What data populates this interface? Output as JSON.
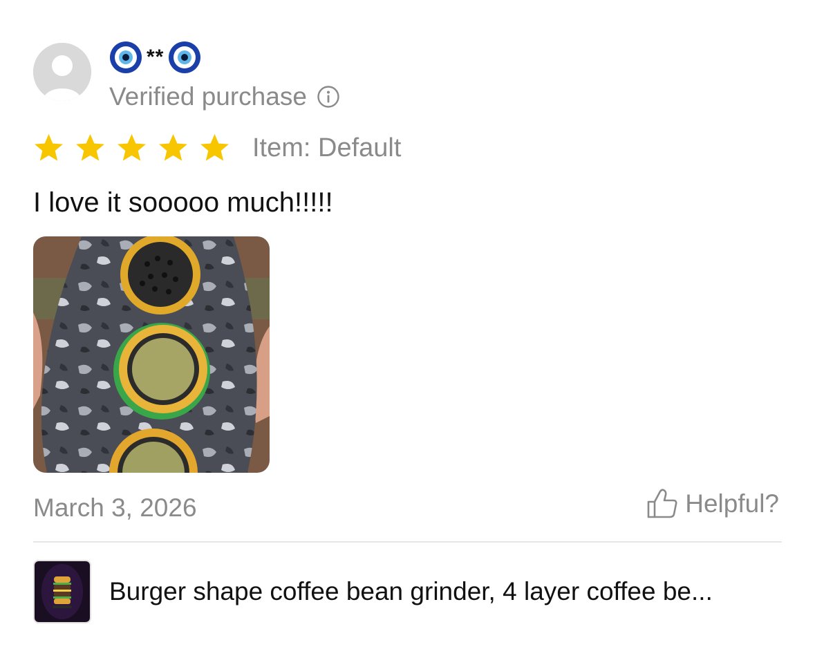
{
  "review": {
    "user_name_masked": "**",
    "verified_label": "Verified purchase",
    "rating": 5,
    "item_label": "Item: Default",
    "text": "I love it sooooo much!!!!!",
    "date": "March 3, 2026",
    "helpful_label": "Helpful?"
  },
  "product": {
    "title": "Burger shape coffee bean grinder, 4 layer coffee be..."
  },
  "colors": {
    "star": "#f7c600",
    "muted_text": "#8a8a8a",
    "divider": "#e6e6e6"
  },
  "icons": {
    "avatar": "default-avatar-icon",
    "name_decoration": "nazar-amulet-icon",
    "info": "info-circle-icon",
    "star": "star-icon",
    "helpful": "thumbs-up-icon"
  }
}
